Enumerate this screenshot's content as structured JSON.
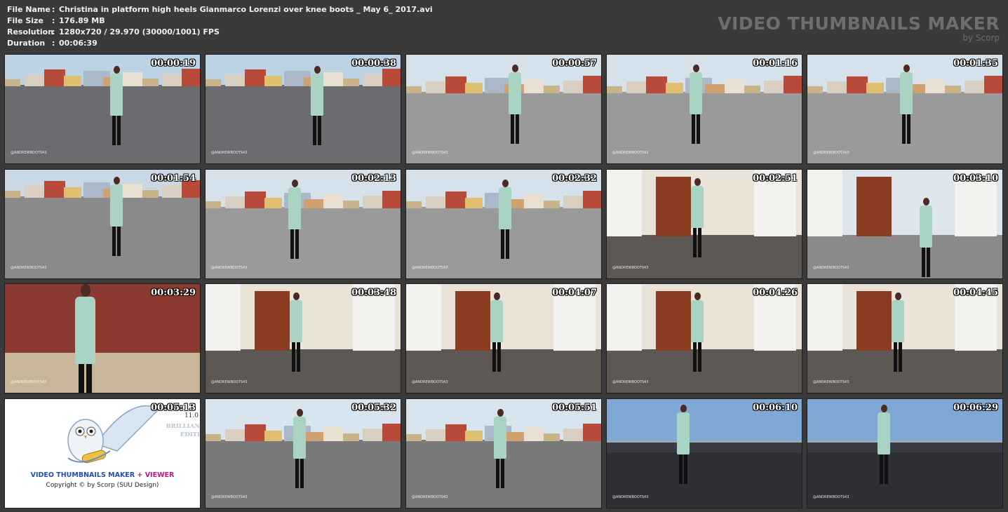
{
  "info": {
    "rows": [
      {
        "key": "File Name",
        "value": "Christina in platform high heels Gianmarco Lorenzi over knee boots _ May 6_ 2017.avi"
      },
      {
        "key": "File Size",
        "value": "176.89 MB"
      },
      {
        "key": "Resolution",
        "value": "1280x720 / 29.970 (30000/1001) FPS"
      },
      {
        "key": "Duration",
        "value": "00:06:39"
      }
    ],
    "separator": ":"
  },
  "brand": {
    "title": "VIDEO THUMBNAILS MAKER",
    "subtitle": "by Scorp"
  },
  "watermark": "@ANDREWBOOTS43",
  "thumbnails": [
    {
      "time": "00:00:19",
      "scene": "fountain"
    },
    {
      "time": "00:00:38",
      "scene": "fountain"
    },
    {
      "time": "00:00:57",
      "scene": "square"
    },
    {
      "time": "00:01:16",
      "scene": "square"
    },
    {
      "time": "00:01:35",
      "scene": "square"
    },
    {
      "time": "00:01:54",
      "scene": "balustrade"
    },
    {
      "time": "00:02:13",
      "scene": "square"
    },
    {
      "time": "00:02:32",
      "scene": "square"
    },
    {
      "time": "00:02:51",
      "scene": "interior"
    },
    {
      "time": "00:03:10",
      "scene": "doorway"
    },
    {
      "time": "00:03:29",
      "scene": "closeup"
    },
    {
      "time": "00:03:48",
      "scene": "interior"
    },
    {
      "time": "00:04:07",
      "scene": "interior"
    },
    {
      "time": "00:04:26",
      "scene": "interior"
    },
    {
      "time": "00:04:45",
      "scene": "interior"
    },
    {
      "time": "00:05:13",
      "scene": "logo"
    },
    {
      "time": "00:05:32",
      "scene": "plaza"
    },
    {
      "time": "00:05:51",
      "scene": "plaza"
    },
    {
      "time": "00:06:10",
      "scene": "seated"
    },
    {
      "time": "00:06:29",
      "scene": "seated"
    }
  ],
  "logo_card": {
    "brand_a": "VIDEO THUMBNAILS MAKER",
    "brand_plus": "+",
    "brand_b": "VIEWER",
    "copyright": "Copyright © by Scorp (SUU Design)",
    "version": "11.0",
    "edition_a": "BRILLIAN",
    "edition_b": "EDITI",
    "colors": {
      "brand_a": "#1e4fb5",
      "brand_b": "#c0187a"
    }
  },
  "colors": {
    "background": "#3a3a3a",
    "header_text": "#f0f0f0",
    "brand": "#6e6e6e",
    "coat": "#a9d3c3"
  }
}
